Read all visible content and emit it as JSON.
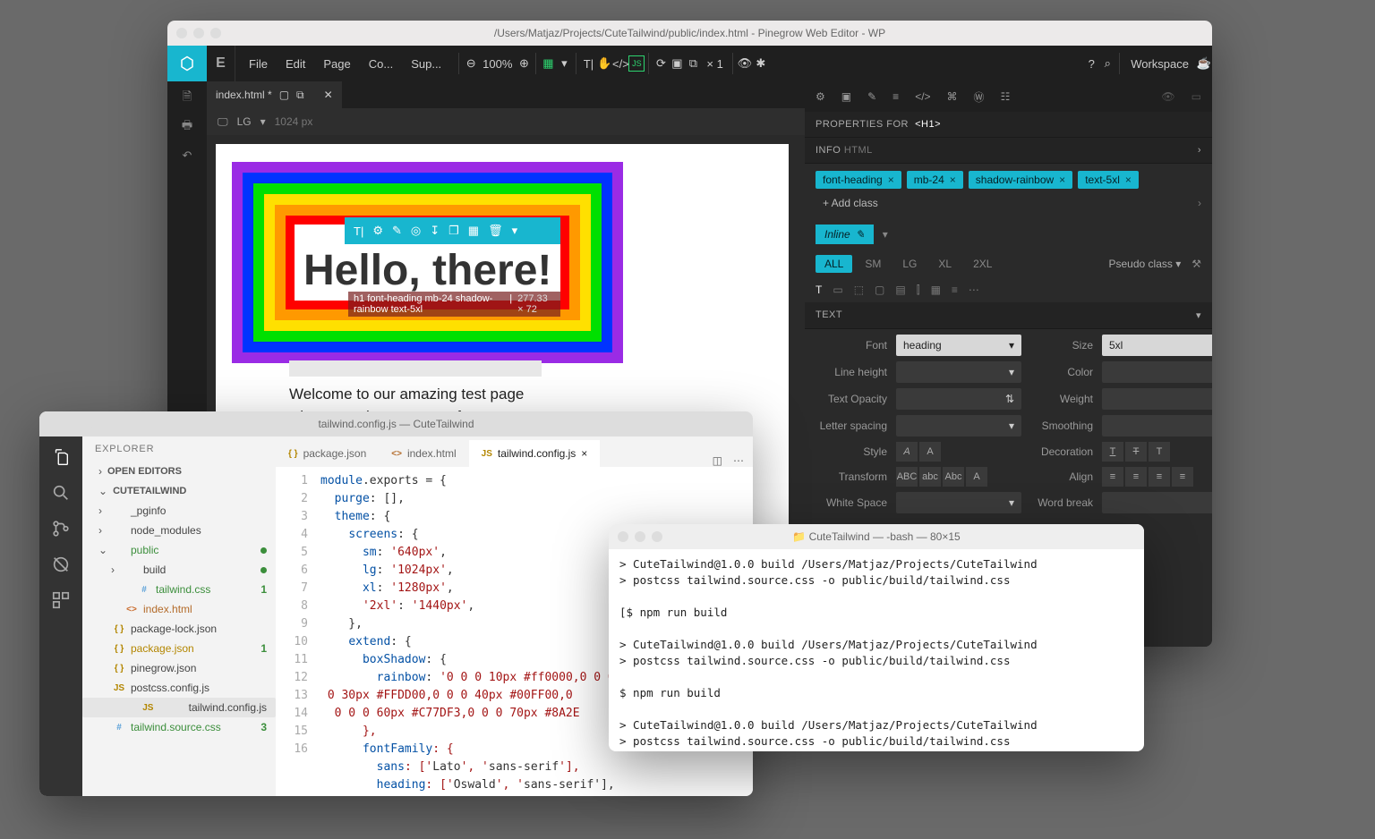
{
  "pinegrow": {
    "title": "/Users/Matjaz/Projects/CuteTailwind/public/index.html - Pinegrow Web Editor - WP",
    "menu": [
      "File",
      "Edit",
      "Page",
      "Co...",
      "Sup..."
    ],
    "zoom": "100%",
    "mult": "× 1",
    "workspace": "Workspace",
    "tab": "index.html *",
    "breakpoint_label": "LG",
    "breakpoint_px": "1024 px",
    "selection": {
      "hello": "Hello, there!",
      "badge": "h1 font-heading mb-24 shadow-rainbow text-5xl",
      "dims": "277.33 × 72",
      "body1": "Welcome to our amazing test page",
      "body2": "where we showcase our fancy"
    },
    "panel": {
      "propfor": "PROPERTIES FOR",
      "propfor_el": "<h1>",
      "info": "INFO",
      "info_sub": "HTML",
      "classes": [
        "font-heading",
        "mb-24",
        "shadow-rainbow",
        "text-5xl"
      ],
      "addclass": "+ Add class",
      "inline": "Inline",
      "bps": [
        "ALL",
        "SM",
        "LG",
        "XL",
        "2XL"
      ],
      "pseudo": "Pseudo class",
      "text_hdr": "TEXT",
      "rows": {
        "font_l": "Font",
        "font_v": "heading",
        "size_l": "Size",
        "size_v": "5xl",
        "lh_l": "Line height",
        "color_l": "Color",
        "opac_l": "Text Opacity",
        "weight_l": "Weight",
        "ls_l": "Letter spacing",
        "smooth_l": "Smoothing",
        "style_l": "Style",
        "deco_l": "Decoration",
        "trans_l": "Transform",
        "align_l": "Align",
        "ws_l": "White Space",
        "wb_l": "Word break"
      }
    }
  },
  "vscode": {
    "title": "tailwind.config.js — CuteTailwind",
    "explorer": "EXPLORER",
    "sections": {
      "open": "OPEN EDITORS",
      "proj": "CUTETAILWIND"
    },
    "tree": [
      {
        "name": "_pginfo",
        "kind": "folder"
      },
      {
        "name": "node_modules",
        "kind": "folder"
      },
      {
        "name": "public",
        "kind": "folder",
        "open": true,
        "color": "#3b8e3b",
        "dot": "#3b8e3b"
      },
      {
        "name": "build",
        "kind": "folder",
        "indent": 1,
        "dot": "#3b8e3b"
      },
      {
        "name": "tailwind.css",
        "kind": "css",
        "indent": 2,
        "color": "#3b8e3b",
        "badge": "1"
      },
      {
        "name": "index.html",
        "kind": "html",
        "indent": 1,
        "color": "#b36b2a"
      },
      {
        "name": "package-lock.json",
        "kind": "json"
      },
      {
        "name": "package.json",
        "kind": "json",
        "color": "#b38600",
        "badge": "1"
      },
      {
        "name": "pinegrow.json",
        "kind": "json"
      },
      {
        "name": "postcss.config.js",
        "kind": "js"
      },
      {
        "name": "tailwind.config.js",
        "kind": "js",
        "sel": true
      },
      {
        "name": "tailwind.source.css",
        "kind": "css",
        "color": "#3b8e3b",
        "badge": "3"
      }
    ],
    "tabs": [
      {
        "pre": "{ }",
        "label": "package.json",
        "color": "#b38600"
      },
      {
        "pre": "<>",
        "label": "index.html",
        "color": "#b36b2a"
      },
      {
        "pre": "JS",
        "label": "tailwind.config.js",
        "color": "#b38600",
        "active": true
      }
    ],
    "code": {
      "lines": [
        1,
        2,
        3,
        4,
        5,
        6,
        7,
        8,
        9,
        10,
        11,
        12,
        "",
        "",
        "",
        13,
        14,
        15,
        16
      ],
      "text": "module.exports = {\n  purge: [],\n  theme: {\n    screens: {\n      sm: '640px',\n      lg: '1024px',\n      xl: '1280px',\n      '2xl': '1440px',\n    },\n    extend: {\n      boxShadow: {\n        rainbow: '0 0 0 10px #ff0000,0 0 0\n 0 30px #FFDD00,0 0 0 40px #00FF00,0\n  0 0 0 60px #C77DF3,0 0 0 70px #8A2E\n      },\n      fontFamily: {\n        sans: ['Lato', 'sans-serif'],\n        heading: ['Oswald', 'sans-serif'],"
    }
  },
  "terminal": {
    "title": "CuteTailwind — -bash — 80×15",
    "lines": [
      "> CuteTailwind@1.0.0 build /Users/Matjaz/Projects/CuteTailwind",
      "> postcss tailwind.source.css -o public/build/tailwind.css",
      "",
      "[$ npm run build",
      "",
      "> CuteTailwind@1.0.0 build /Users/Matjaz/Projects/CuteTailwind",
      "> postcss tailwind.source.css -o public/build/tailwind.css",
      "",
      "$ npm run build",
      "",
      "> CuteTailwind@1.0.0 build /Users/Matjaz/Projects/CuteTailwind",
      "> postcss tailwind.source.css -o public/build/tailwind.css",
      "",
      "$ ▯"
    ]
  }
}
